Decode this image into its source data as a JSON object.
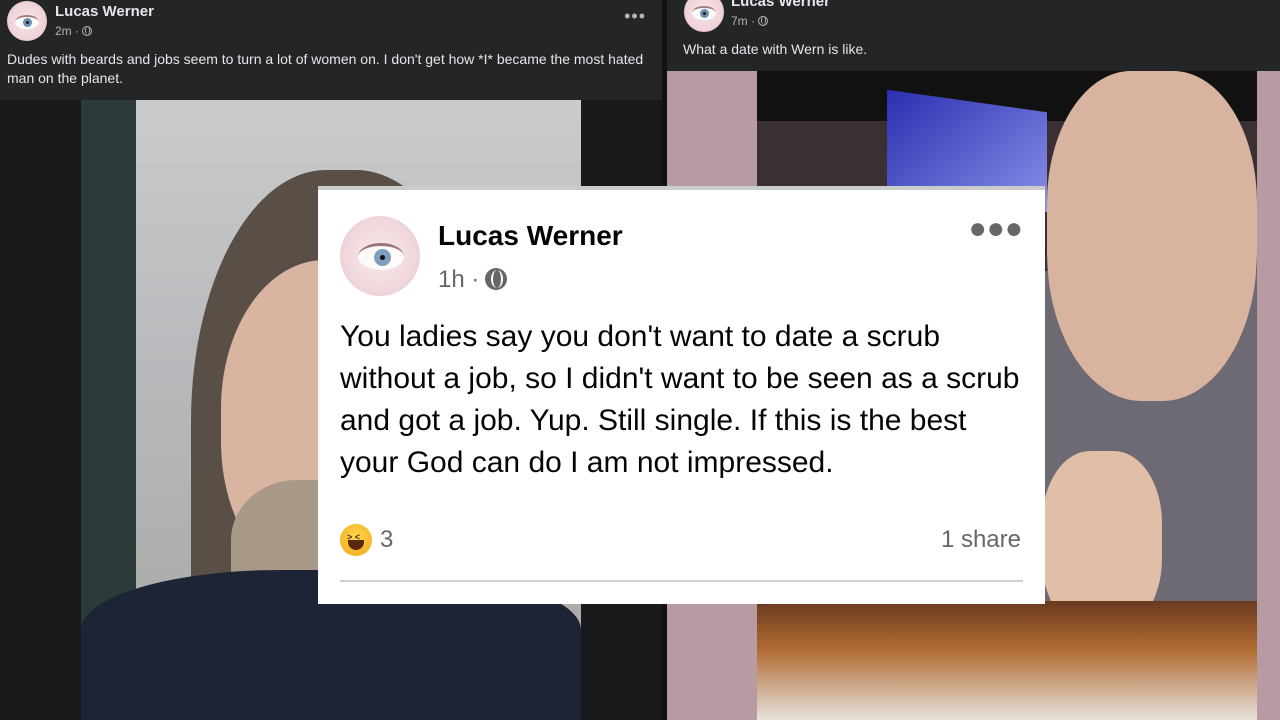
{
  "left_post": {
    "author": "Lucas Werner",
    "time": "2m ·",
    "text": "Dudes with beards and jobs seem to turn a lot of women on. I don't get how *I* became the most hated man on the planet.",
    "more_icon": "more-horizontal-icon"
  },
  "right_post": {
    "author": "Lucas Werner",
    "time": "7m ·",
    "text": "What a date with Wern is like."
  },
  "center_post": {
    "author": "Lucas Werner",
    "time": "1h ·",
    "text": "You ladies say you don't want to date a scrub without a job, so I didn't want to be seen as a scrub and got a job. Yup. Still single. If this is the best your God can do I am not impressed.",
    "reaction_count": "3",
    "shares": "1 share",
    "more_icon": "more-horizontal-icon",
    "reaction_icon": "haha-reaction-icon"
  },
  "colors": {
    "dark_bg": "#242526",
    "card_bg": "#ffffff",
    "right_bg": "#b79aa2"
  }
}
